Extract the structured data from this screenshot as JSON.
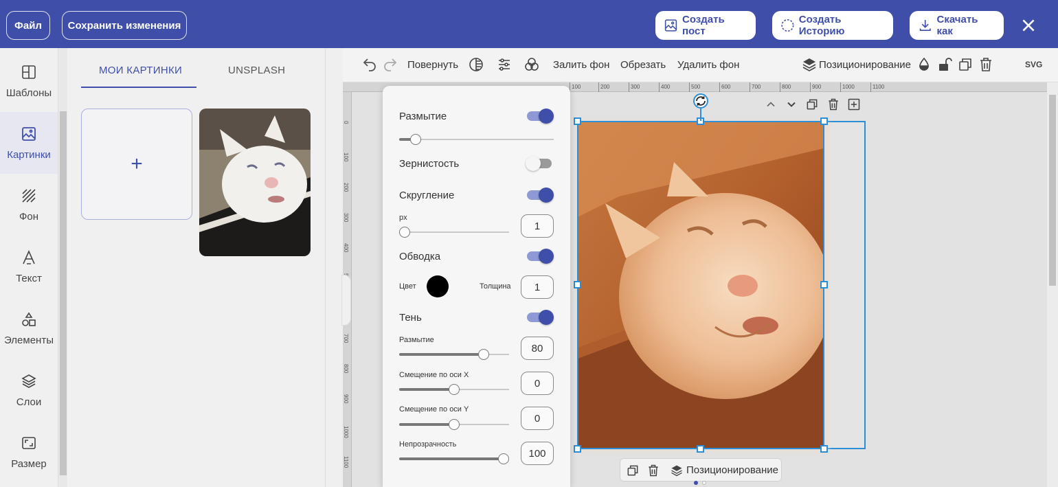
{
  "topbar": {
    "file_label": "Файл",
    "save_label": "Сохранить изменения",
    "create_post_label": "Создать пост",
    "create_story_label": "Создать Историю",
    "download_label": "Скачать как"
  },
  "sidebar": {
    "items": [
      {
        "label": "Шаблоны",
        "icon": "templates-icon"
      },
      {
        "label": "Картинки",
        "icon": "image-icon"
      },
      {
        "label": "Фон",
        "icon": "background-icon"
      },
      {
        "label": "Текст",
        "icon": "text-icon"
      },
      {
        "label": "Элементы",
        "icon": "elements-icon"
      },
      {
        "label": "Слои",
        "icon": "layers-icon"
      },
      {
        "label": "Размер",
        "icon": "resize-icon"
      }
    ],
    "active_index": 1
  },
  "panel": {
    "tabs": [
      "МОИ КАРТИНКИ",
      "UNSPLASH"
    ],
    "add_symbol": "+"
  },
  "toolbar": {
    "rotate_label": "Повернуть",
    "fill_bg_label": "Залить фон",
    "crop_label": "Обрезать",
    "remove_bg_label": "Удалить фон",
    "positioning_label": "Позиционирование",
    "svg_label": "SVG"
  },
  "ruler": {
    "h_ticks": [
      "100",
      "200",
      "300",
      "400",
      "500",
      "600",
      "700",
      "800",
      "900",
      "1000",
      "1100"
    ],
    "v_ticks": [
      "0",
      "100",
      "200",
      "300",
      "400",
      "500",
      "600",
      "700",
      "800",
      "900",
      "1000",
      "1100"
    ]
  },
  "effects": {
    "blur": {
      "label": "Размытие",
      "enabled": true,
      "value_fraction": 0.11
    },
    "grain": {
      "label": "Зернистость",
      "enabled": false
    },
    "rounding": {
      "label": "Скругление",
      "enabled": true,
      "unit_label": "px",
      "value": "1"
    },
    "stroke": {
      "label": "Обводка",
      "enabled": true,
      "color_label": "Цвет",
      "color": "#000000",
      "thickness_label": "Толщина",
      "thickness": "1"
    },
    "shadow": {
      "label": "Тень",
      "enabled": true,
      "blur_label": "Размытие",
      "blur": "80",
      "offset_x_label": "Смещение по оси X",
      "offset_x": "0",
      "offset_y_label": "Смещение по оси Y",
      "offset_y": "0",
      "opacity_label": "Непрозрачность",
      "opacity": "100"
    }
  },
  "canvas_bar": {
    "positioning_label": "Позиционирование"
  },
  "colors": {
    "brand": "#3f4ea8",
    "selection": "#2a8fd6"
  }
}
